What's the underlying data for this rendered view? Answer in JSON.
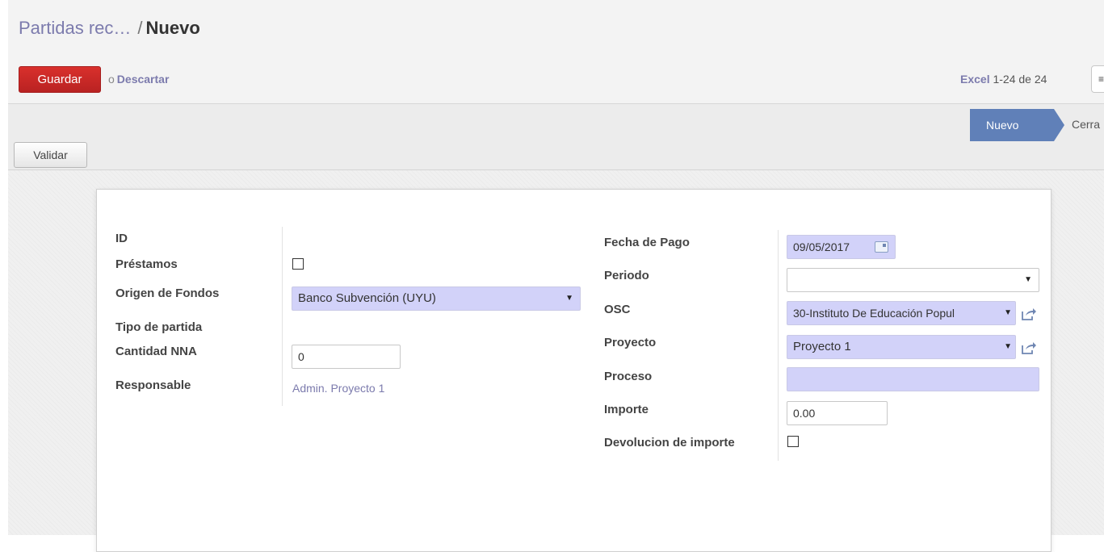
{
  "breadcrumb": {
    "parent": "Partidas rec…",
    "separator": "/",
    "current": "Nuevo"
  },
  "toolbar": {
    "save_label": "Guardar",
    "or_text": "o",
    "discard_label": "Descartar"
  },
  "pager": {
    "excel_label": "Excel",
    "range": "1-24 de 24",
    "menu_icon": "≡"
  },
  "statusbar": {
    "stages": [
      "Nuevo",
      "Cerra"
    ],
    "active_stage": "Nuevo",
    "validate_label": "Validar"
  },
  "form": {
    "left": {
      "id_label": "ID",
      "prestamos_label": "Préstamos",
      "origen_label": "Origen de Fondos",
      "origen_value": "Banco Subvención (UYU)",
      "tipo_label": "Tipo de partida",
      "cantidad_label": "Cantidad NNA",
      "cantidad_value": "0",
      "responsable_label": "Responsable",
      "responsable_value": "Admin. Proyecto 1"
    },
    "right": {
      "fecha_label": "Fecha de Pago",
      "fecha_value": "09/05/2017",
      "periodo_label": "Periodo",
      "periodo_value": "",
      "osc_label": "OSC",
      "osc_value": "30-Instituto De Educación Popul",
      "proyecto_label": "Proyecto",
      "proyecto_value": "Proyecto 1",
      "proceso_label": "Proceso",
      "proceso_value": "",
      "importe_label": "Importe",
      "importe_value": "0.00",
      "devolucion_label": "Devolucion de importe"
    }
  },
  "colors": {
    "accent": "#7c7bad",
    "save_button": "#c9292a",
    "stage_active": "#6080b8",
    "required_field": "#d2d2f9"
  }
}
